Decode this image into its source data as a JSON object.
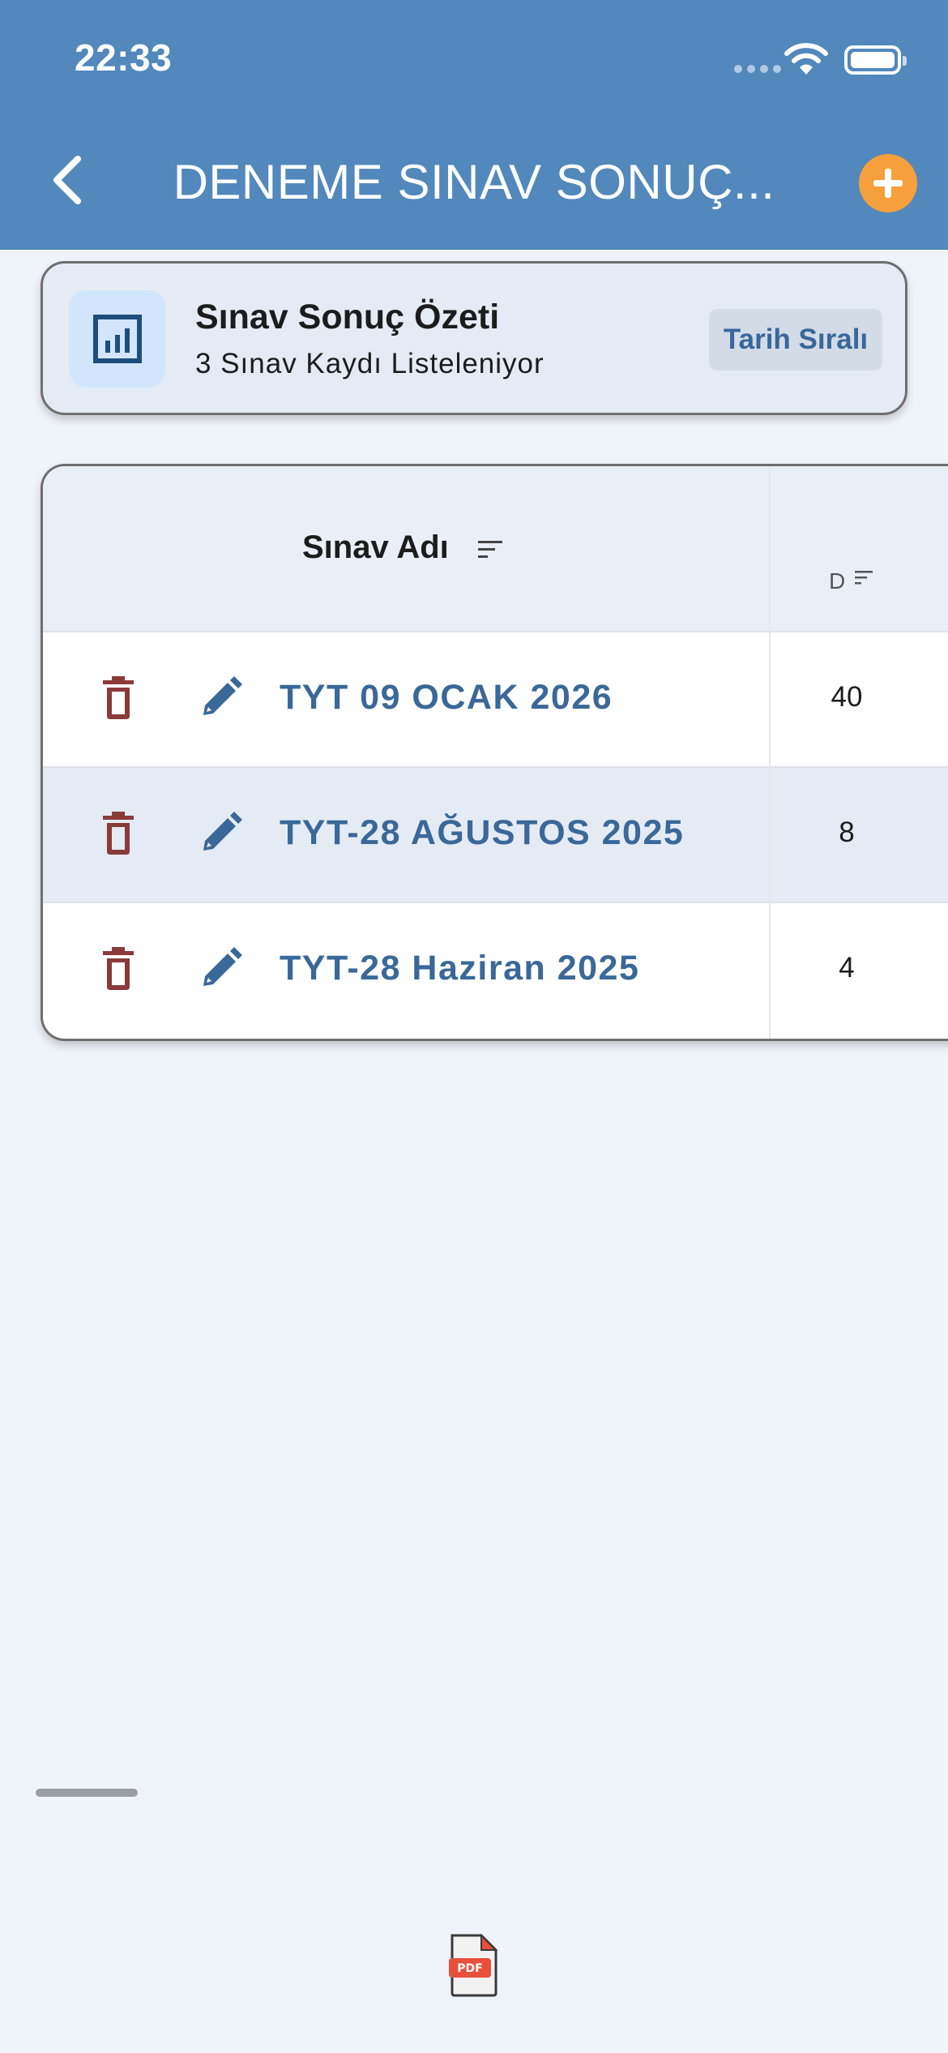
{
  "status_bar": {
    "time": "22:33"
  },
  "header": {
    "title": "DENEME SINAV SONUÇ..."
  },
  "summary": {
    "title": "Sınav Sonuç Özeti",
    "subtitle": "3 Sınav Kaydı Listeleniyor",
    "sort_label": "Tarih Sıralı"
  },
  "table": {
    "columns": [
      "Sınav Adı",
      "D"
    ],
    "rows": [
      {
        "name": "TYT 09 OCAK 2026",
        "d": "40"
      },
      {
        "name": "TYT-28 AĞUSTOS 2025",
        "d": "8"
      },
      {
        "name": "TYT-28 Haziran 2025",
        "d": "4"
      }
    ]
  },
  "footer": {
    "export_icon": "pdf-file-icon"
  },
  "colors": {
    "app_bar": "#5288bc",
    "accent": "#f5a03c",
    "link_text": "#3a6898",
    "delete_icon": "#8b3a3a",
    "background": "#eff4fa"
  }
}
